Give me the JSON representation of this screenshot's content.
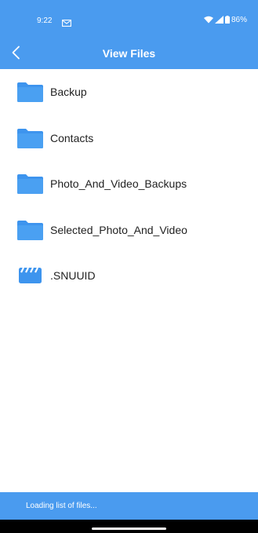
{
  "status_bar": {
    "time": "9:22",
    "battery": "86%",
    "icons": [
      "mail-icon",
      "wifi-icon",
      "signal-icon",
      "battery-icon"
    ]
  },
  "app_bar": {
    "title": "View Files",
    "back_icon": "back-arrow-icon"
  },
  "files": [
    {
      "name": "Backup",
      "icon": "folder-icon"
    },
    {
      "name": "Contacts",
      "icon": "folder-icon"
    },
    {
      "name": "Photo_And_Video_Backups",
      "icon": "folder-icon"
    },
    {
      "name": "Selected_Photo_And_Video",
      "icon": "folder-icon"
    },
    {
      "name": ".SNUUID",
      "icon": "video-clapperboard-icon"
    }
  ],
  "footer": {
    "loading_text": "Loading list of files..."
  },
  "colors": {
    "primary": "#4a9bef",
    "folder": "#3d94ee",
    "text": "#222222"
  }
}
